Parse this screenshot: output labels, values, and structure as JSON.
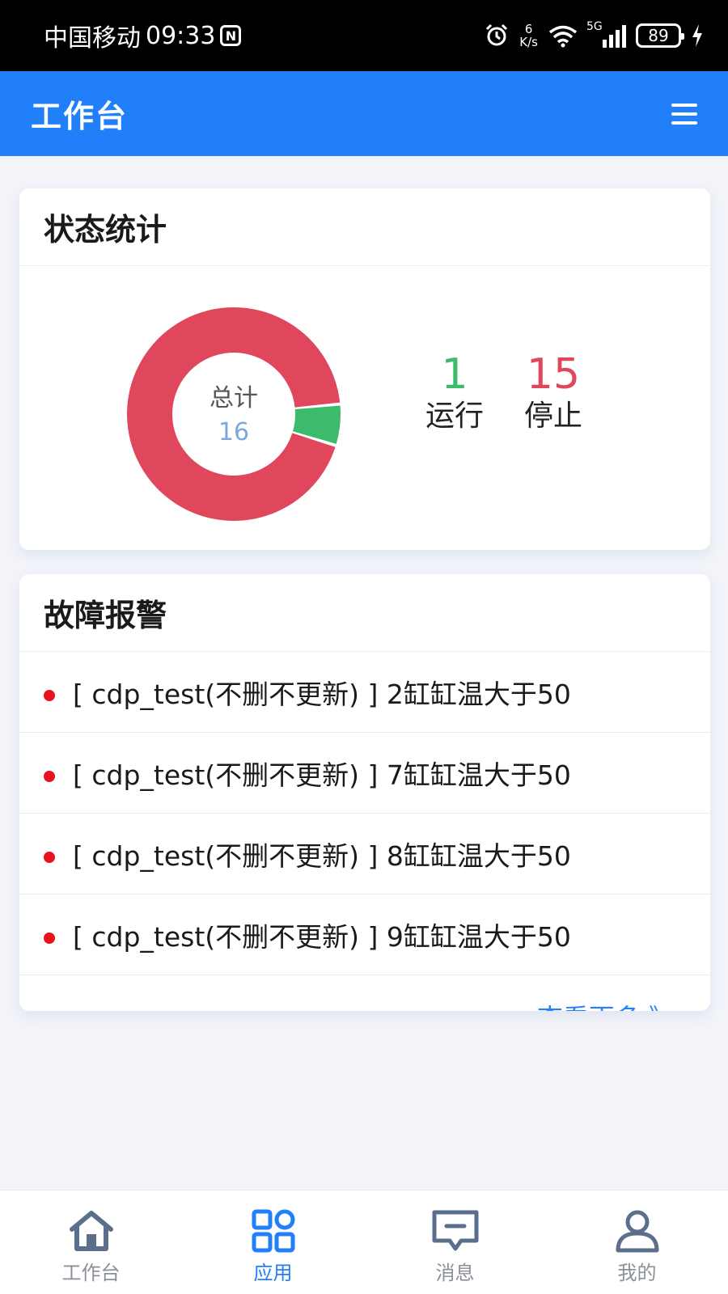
{
  "status_bar": {
    "carrier": "中国移动",
    "time": "09:33",
    "speed_value": "6",
    "speed_unit": "K/s",
    "network": "5G",
    "battery": "89"
  },
  "header": {
    "title": "工作台"
  },
  "stats": {
    "title": "状态统计",
    "center_label": "总计",
    "total": "16",
    "running_count": "1",
    "running_label": "运行",
    "stopped_count": "15",
    "stopped_label": "停止"
  },
  "chart_data": {
    "type": "pie",
    "categories": [
      "运行",
      "停止"
    ],
    "values": [
      1,
      15
    ],
    "colors": [
      "#3dbb6d",
      "#e0475c"
    ],
    "donut": true
  },
  "alarms": {
    "title": "故障报警",
    "items": [
      "[ cdp_test(不删不更新) ] 2缸缸温大于50",
      "[ cdp_test(不删不更新) ] 7缸缸温大于50",
      "[ cdp_test(不删不更新) ] 8缸缸温大于50",
      "[ cdp_test(不删不更新) ] 9缸缸温大于50"
    ],
    "more": "查看更多 》"
  },
  "tabs": [
    {
      "label": "工作台",
      "icon": "home-icon"
    },
    {
      "label": "应用",
      "icon": "apps-icon"
    },
    {
      "label": "消息",
      "icon": "message-icon"
    },
    {
      "label": "我的",
      "icon": "user-icon"
    }
  ],
  "colors": {
    "primary": "#2180f9",
    "running": "#3dbb6d",
    "stopped": "#e0475c",
    "alarm_dot": "#e8141c",
    "total": "#7ba8db",
    "inactive_tab": "#5b6e8c"
  }
}
